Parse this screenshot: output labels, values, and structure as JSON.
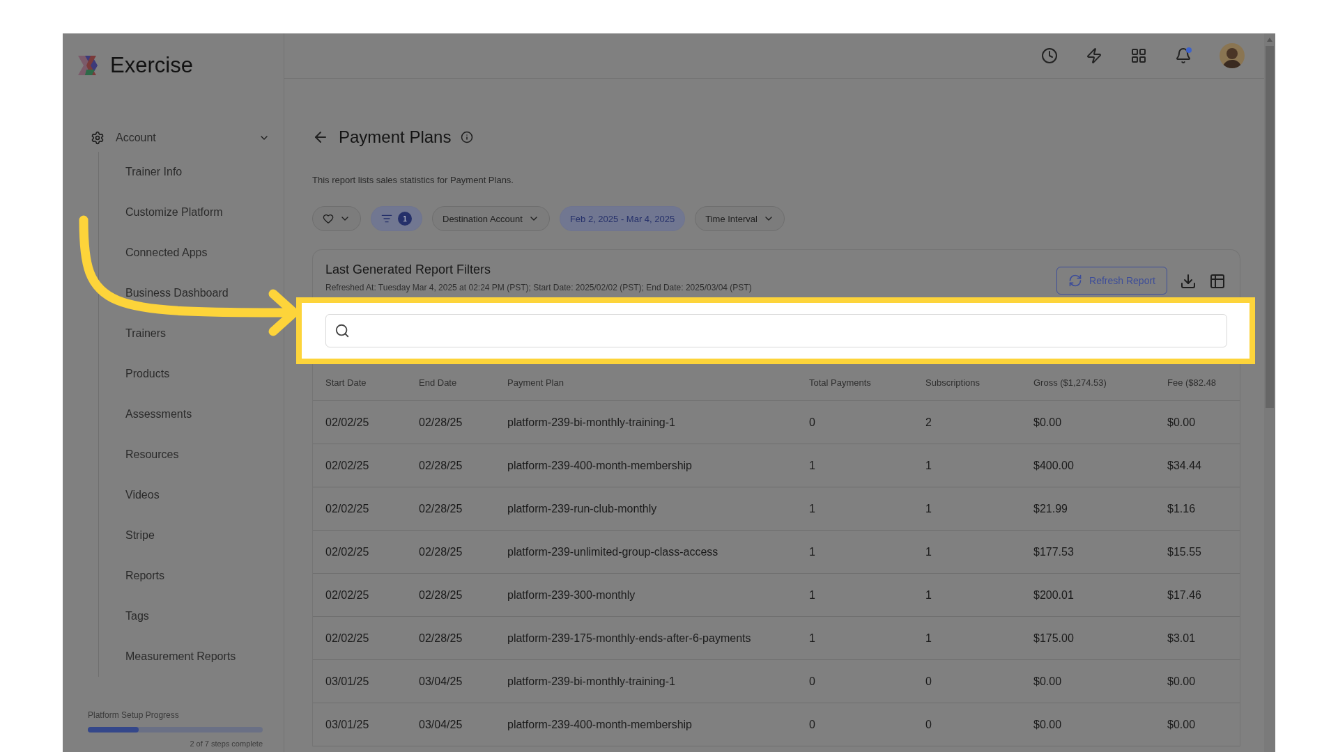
{
  "logo": {
    "name": "Exercise"
  },
  "sidebar": {
    "section": {
      "label": "Account",
      "expanded": true
    },
    "items": [
      "Trainer Info",
      "Customize Platform",
      "Connected Apps",
      "Business Dashboard",
      "Trainers",
      "Products",
      "Assessments",
      "Resources",
      "Videos",
      "Stripe",
      "Reports",
      "Tags",
      "Measurement Reports"
    ],
    "progress": {
      "label": "Platform Setup Progress",
      "level": 0.29,
      "caption": "2 of 7 steps complete"
    }
  },
  "topbar": {
    "notifications": {
      "unread": true
    }
  },
  "page": {
    "title": "Payment Plans",
    "description": "This report lists sales statistics for Payment Plans."
  },
  "filters": [
    {
      "kind": "favorite"
    },
    {
      "kind": "filter",
      "count": "1"
    },
    {
      "kind": "dropdown",
      "label": "Destination Account"
    },
    {
      "kind": "date",
      "label": "Feb 2, 2025 - Mar 4, 2025"
    },
    {
      "kind": "dropdown",
      "label": "Time Interval"
    }
  ],
  "report": {
    "title": "Last Generated Report Filters",
    "refreshed": "Refreshed At: Tuesday Mar 4, 2025 at 02:24 PM (PST); Start Date: 2025/02/02 (PST); End Date: 2025/03/04 (PST)",
    "refresh_button": "Refresh Report"
  },
  "search": {
    "highlighted": true
  },
  "table": {
    "columns": [
      "Start Date",
      "End Date",
      "Payment Plan",
      "Total Payments",
      "Subscriptions",
      "Gross ($1,274.53)",
      "Fee ($82.48"
    ],
    "rows": [
      [
        "02/02/25",
        "02/28/25",
        "platform-239-bi-monthly-training-1",
        "0",
        "2",
        "$0.00",
        "$0.00"
      ],
      [
        "02/02/25",
        "02/28/25",
        "platform-239-400-month-membership",
        "1",
        "1",
        "$400.00",
        "$34.44"
      ],
      [
        "02/02/25",
        "02/28/25",
        "platform-239-run-club-monthly",
        "1",
        "1",
        "$21.99",
        "$1.16"
      ],
      [
        "02/02/25",
        "02/28/25",
        "platform-239-unlimited-group-class-access",
        "1",
        "1",
        "$177.53",
        "$15.55"
      ],
      [
        "02/02/25",
        "02/28/25",
        "platform-239-300-monthly",
        "1",
        "1",
        "$200.01",
        "$17.46"
      ],
      [
        "02/02/25",
        "02/28/25",
        "platform-239-175-monthly-ends-after-6-payments",
        "1",
        "1",
        "$175.00",
        "$3.01"
      ],
      [
        "03/01/25",
        "03/04/25",
        "platform-239-bi-monthly-training-1",
        "0",
        "0",
        "$0.00",
        "$0.00"
      ],
      [
        "03/01/25",
        "03/04/25",
        "platform-239-400-month-membership",
        "0",
        "0",
        "$0.00",
        "$0.00"
      ]
    ]
  }
}
